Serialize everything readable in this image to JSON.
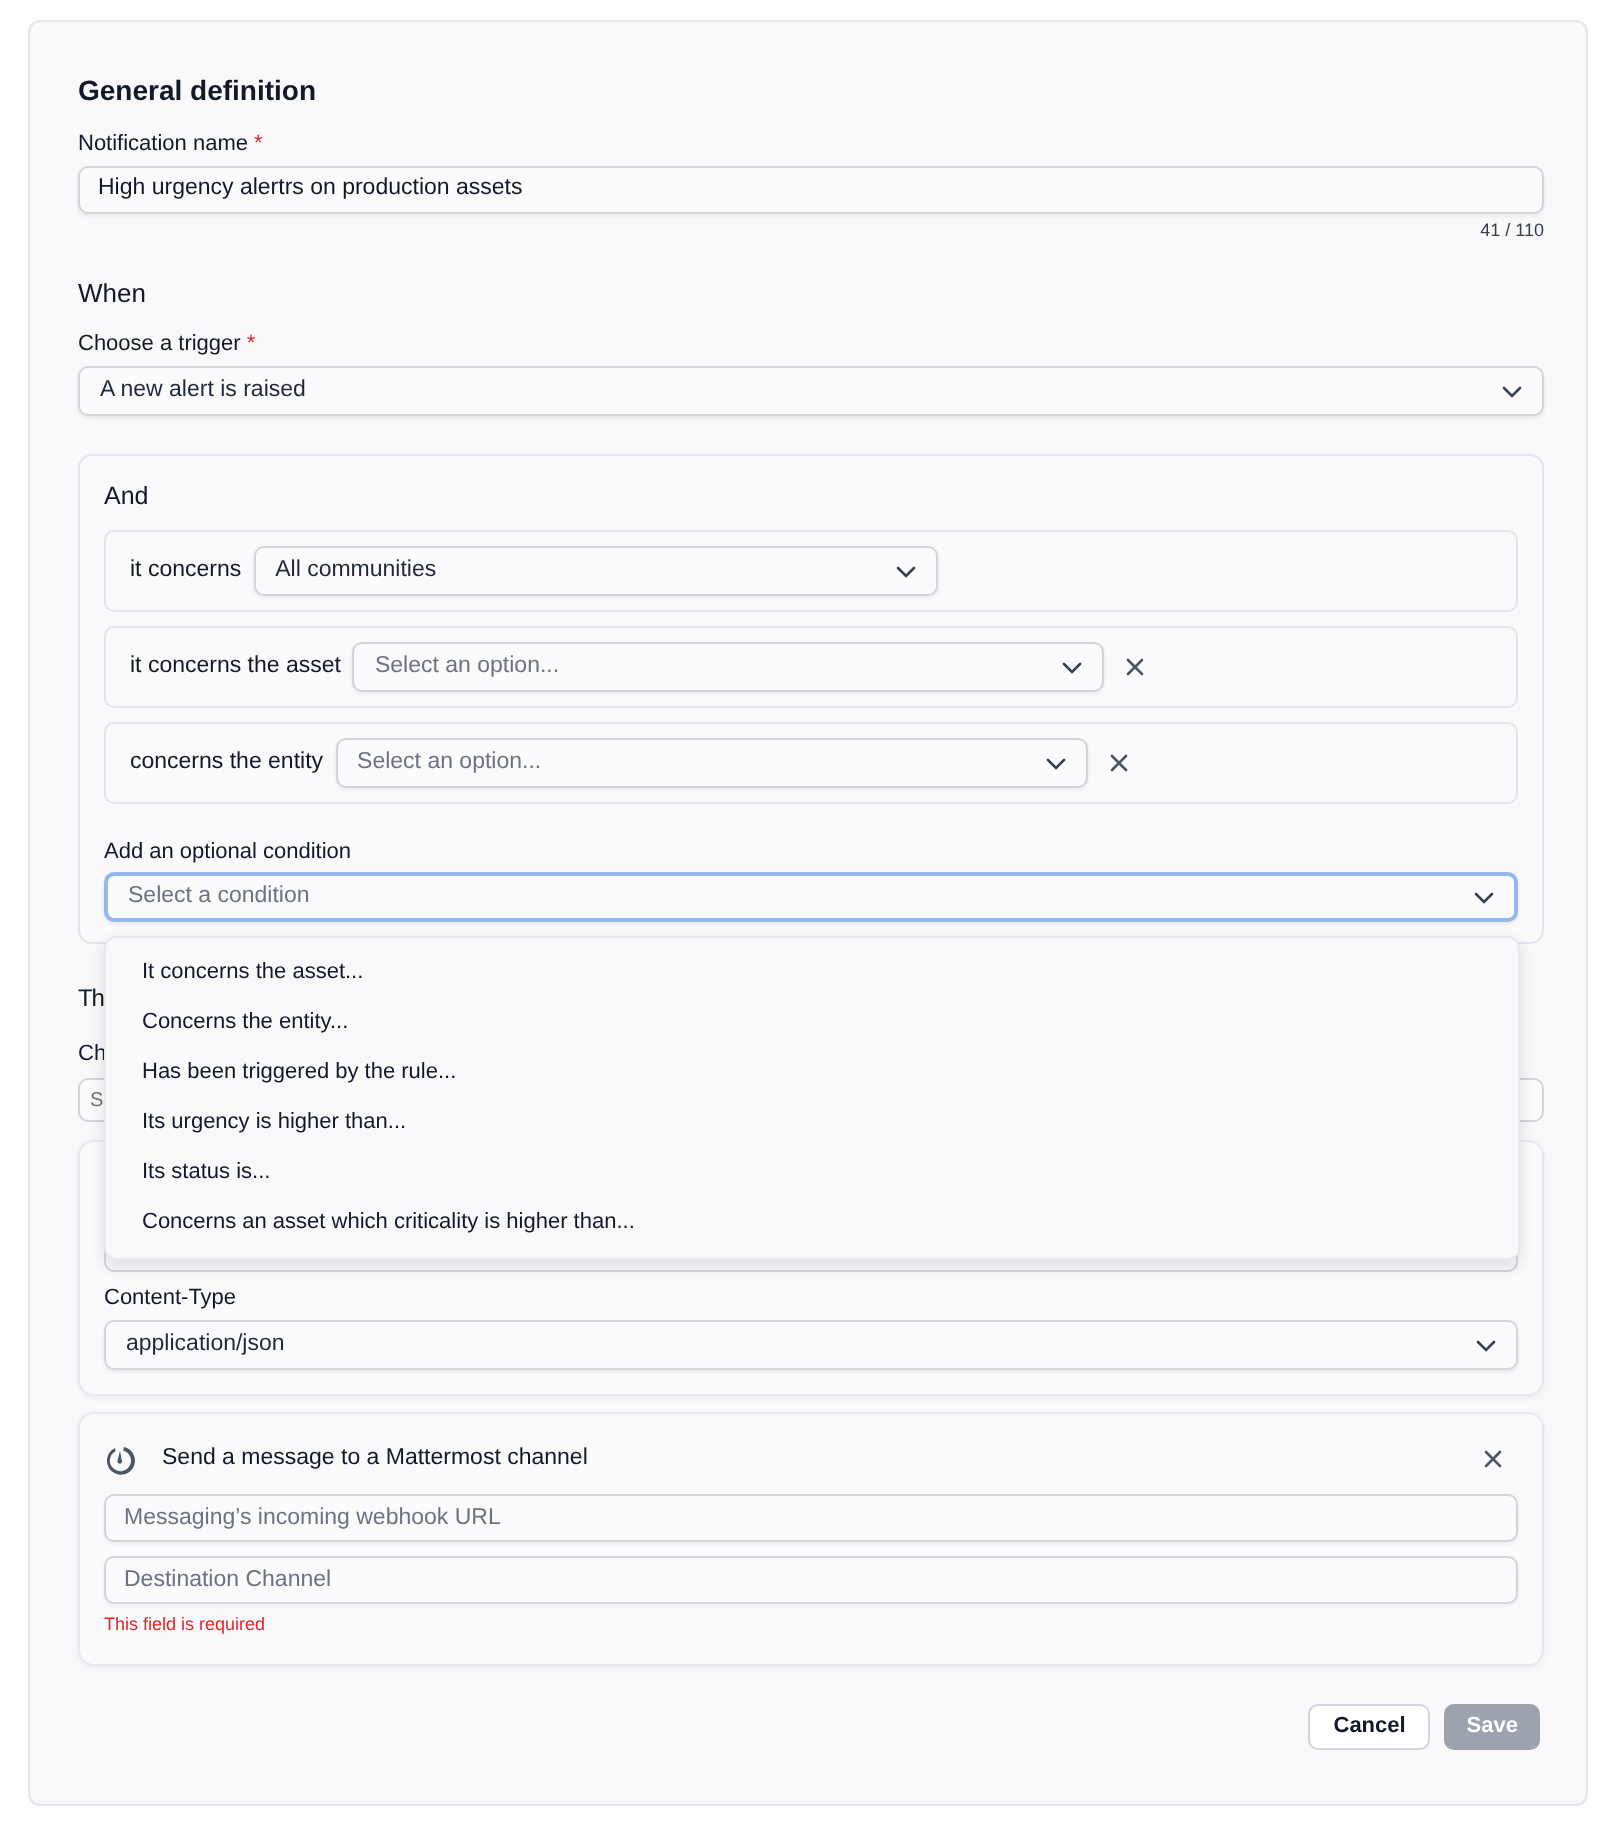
{
  "general": {
    "title": "General definition",
    "name_field": {
      "label": "Notification name",
      "required_mark": "*",
      "value": "High urgency alertrs on production assets",
      "counter": "41 / 110"
    }
  },
  "when": {
    "title": "When",
    "trigger": {
      "label": "Choose a trigger",
      "required_mark": "*",
      "value": "A new alert is raised"
    },
    "and": {
      "title": "And",
      "conditions": [
        {
          "label": "it concerns",
          "value": "All communities",
          "removable": false
        },
        {
          "label": "it concerns the asset",
          "placeholder": "Select an option...",
          "removable": true
        },
        {
          "label": "concerns the entity",
          "placeholder": "Select an option...",
          "removable": true
        }
      ],
      "optional_condition": {
        "label": "Add an optional condition",
        "placeholder": "Select a condition",
        "expanded": true,
        "options": [
          "It concerns the asset...",
          "Concerns the entity...",
          "Has been triggered by the rule...",
          "Its urgency is higher than...",
          "Its status is...",
          "Concerns an asset which criticality is higher than..."
        ]
      }
    }
  },
  "then": {
    "title": "Th",
    "channel_label": "Ch",
    "channel_value": "S"
  },
  "actions": [
    {
      "kind": "webhook",
      "content_type_label": "Content-Type",
      "content_type": "application/json"
    },
    {
      "kind": "mattermost",
      "title": "Send a message to a Mattermost channel",
      "fields": [
        {
          "placeholder": "Messaging’s incoming webhook URL"
        },
        {
          "placeholder": "Destination Channel",
          "error": "This field is required"
        }
      ]
    }
  ],
  "buttons": [
    {
      "label": "Cancel",
      "kind": "secondary",
      "disabled": false
    },
    {
      "label": "Save",
      "kind": "primary",
      "disabled": true
    }
  ]
}
